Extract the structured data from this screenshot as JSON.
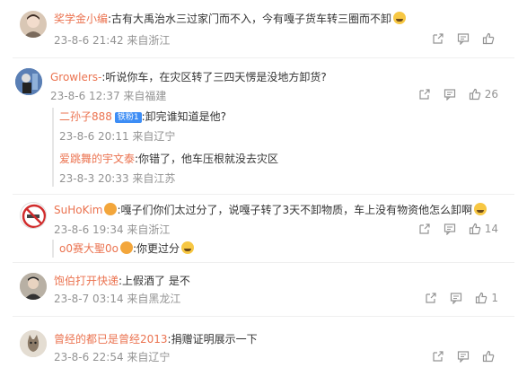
{
  "comments": [
    {
      "user": "奖学金小编",
      "text": ":古有大禹治水三过家门而不入，今有嘎子货车转三圈而不卸",
      "meta": "23-8-6 21:42 来自浙江",
      "likes": ""
    },
    {
      "user": "Growlers-",
      "text": ":听说你车，在灾区转了三四天愣是没地方卸货?",
      "meta": "23-8-6 12:37 来自福建",
      "likes": "26",
      "replies": [
        {
          "user": "二孙子888",
          "badge": "铁粉1",
          "text": ":卸完谁知道是他?",
          "meta": "23-8-6 20:11 来自辽宁"
        },
        {
          "user": "爱跳舞的宇文泰",
          "text": ":你错了，他车压根就没去灾区",
          "meta": "23-8-3 20:33 来自江苏"
        }
      ]
    },
    {
      "user": "SuHoKim",
      "text": ":嘎子们你们太过分了，说嘎子转了3天不卸物质，车上没有物资他怎么卸啊",
      "meta": "23-8-6 19:34 来自浙江",
      "likes": "14",
      "replies": [
        {
          "user": "o0赛大聖0o",
          "text": ":你更过分",
          "meta": ""
        }
      ]
    },
    {
      "user": "饱伯打开快递",
      "text": ":上假酒了 是不",
      "meta": "23-8-7 03:14 来自黑龙江",
      "likes": "1"
    },
    {
      "user": "曾经的都已是曾经2013",
      "text": ":捐赠证明展示一下",
      "meta": "23-8-6 22:54 来自辽宁",
      "likes": ""
    }
  ],
  "colors": {
    "username": "#eb7350",
    "meta": "#939393",
    "badge": "#3d8df5"
  },
  "icons": {
    "forward": "share-square-icon",
    "comment": "comment-bubble-icon",
    "like": "thumb-up-icon"
  }
}
